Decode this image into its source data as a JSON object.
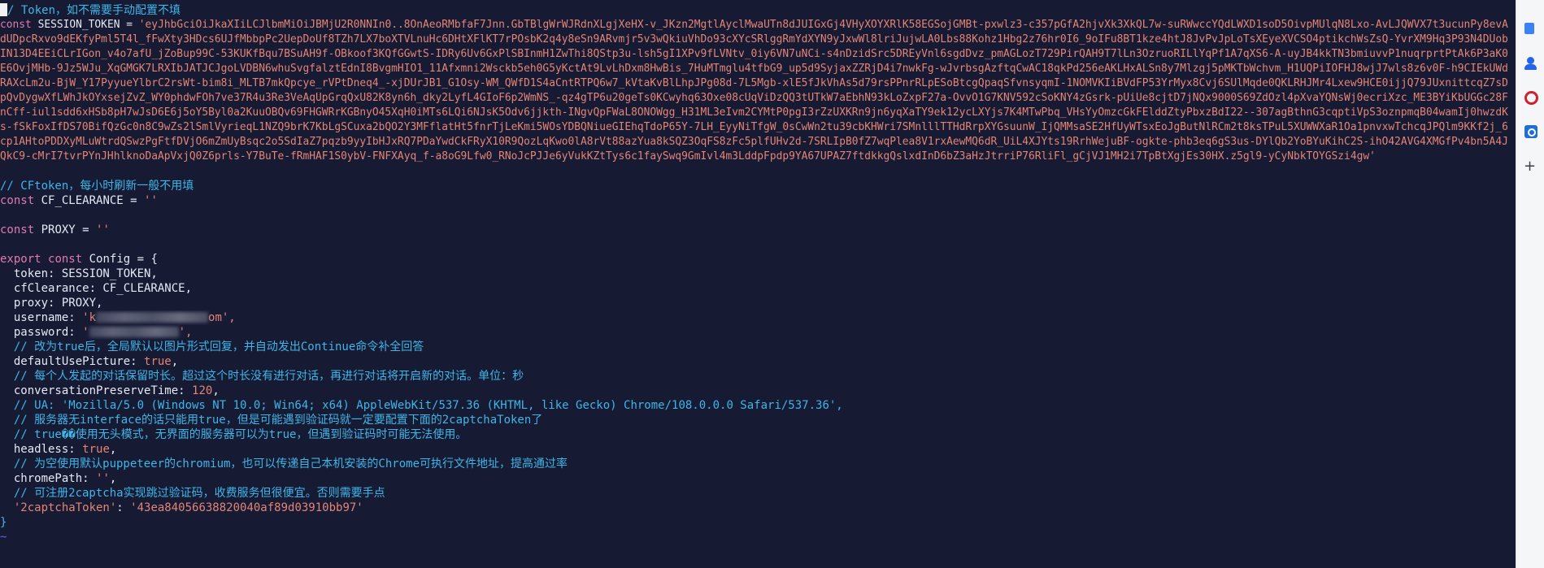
{
  "editor": {
    "comment_token": "/ Token，如不需要手动配置不填",
    "session_kw": "const",
    "session_name": "SESSION_TOKEN",
    "session_eq": " = ",
    "session_token_value": "'eyJhbGciOiJkaXIiLCJlbmMiOiJBMjU2R0NNIn0..8OnAeoRMbfaF7Jnn.GbTBlgWrWJRdnXLgjXeHX-v_JKzn2MgtlAyclMwaUTn8dJUIGxGj4VHyXOYXRlK58EGSojGMBt-pxwlz3-c357pGfA2hjvXk3XkQL7w-suRWwccYQdLWXD1soD5OivpMUlqN8Lxo-AvLJQWVX7t3ucunPy8evAdUDpcRxvo9dEKfyPml5T4l_fFwXty3HDcs6UJfMbbpPc2UepDoUf8TZh7LX7boXTVLnuHc6DHtXFlKT7rPOsbK2q4y8eSn9ARvmjr5v3wQkiuVhDo93cXYcSRlggRmYdXYN9yJxwWl8lriJujwLA0Lbs88Kohz1Hbg2z76hr0I6_9oIFu8BT1kze4htJ8JvPvJpLoTsXEyeXVCSO4ptikchWsZsQ-YvrXM9Hq3P93N4DUobIN13D4EEiCLrIGon_v4o7afU_jZoBup99C-53KUKfBqu7BSuAH9f-OBkoof3KQfGGwtS-IDRy6Uv6GxPlSBInmH1ZwThi8QStp3u-lsh5gI1XPv9fLVNtv_0iy6VN7uNCi-s4nDzidSrc5DREyVnl6sgdDvz_pmAGLozT729PirQAH9T7lLn3OzruoRILlYqPf1A7qXS6-A-uyJB4kkTN3bmiuvvP1nuqrprtPtAk6P3aK0E6OvjMHb-9Jz5WJu_XqGMGK7LRXIbJATJCJgoLVDBN6whuSvgfalztEdnI8BvgmHIO1_11Afxmni2Wsckb5eh0G5yKctAt9LvLhDxm8HwBis_7HuMTmglu4tfbG9_up5d9SyjaxZZRjD4i7nwkFg-wJvrbsgAzftqCwAC18qkPd256eAKLHxALSn8y7Mlzgj5pMKTbWchvm_H1UQPiIOFHJ8wjJ7wls8z6v0F-h9CIEkUWdRAXcLm2u-BjW_Y17PyyueYlbrC2rsWt-bim8i_MLTB7mkQpcye_rVPtDneq4_-xjDUrJB1_G1Osy-WM_QWfD1S4aCntRTPQ6w7_kVtaKvBlLhpJPg08d-7L5Mgb-xlE5fJkVhAs5d79rsPPnrRLpESoBtcgQpaqSfvnsyqmI-1NOMVKIiBVdFP53YrMyx8Cvj6SUlMqde0QKLRHJMr4Lxew9HCE0ijjQ79JUxnittcqZ7sDpQvDygwXfLWhJkOYxsejZvZ_WY0phdwFOh7ve37R4u3Re3VeAqUpGrqQxU82K8yn6h_dky2LyfL4GIoF6p2WmNS_-qz4gTP6u20geTs0KCwyhq63Oxe08cUqViDzQQ3tUTkW7aEbhN93kLoZxpF27a-OvvO1G7KNV592cSoKNY4zGsrk-pUiUe8cjtD7jNQx9000S69ZdOzl4pXvaYQNsWj0ecriXzc_ME3BYiKbUGGc28FnCff-iul1sdd6xHSb8pH7wJsD6E6j5oY5Byl0a2KuuOBQv69FHGWRrKGBnyO45XqH0iMTs6LQi6NJsK5Odv6jjkth-INgvQpFWaL8ONOWgg_H31ML3eIvm2CYMtP0pgI3rZzUXKRn9jn6yqXaTY9ek12ycLXYjs7K4MTwPbq_VHsYyOmzcGkFElddZtyPbxzBdI22--307agBthnG3cqptiVpS3oznpmqB04wamIj0hwzdKs-fSkFoxIfDS70BifQzGc0n8C9wZs2lSmlVyrieqL1NZQ9brK7KbLgSCuxa2bQO2Y3MFflatHt5fnrTjLeKmi5WOsYDBQNiueGIEhqTdoP65Y-7LH_EyyNiTfgW_0sCwWn2tu39cbKHWri7SMnlllTTHdRrpXYGsuunW_IjQMMsaSE2HfUyWTsxEoJgButNlRCm2t8ksTPuL5XUWWXaR1Oa1pnvxwTchcqJPQlm9KKf2j_6cp1AHtoPDDXyMLuWtrdQSwzPgFtfDVjO6mZmUyBsqc2o5SdIaZ7pqzb9yyIbHJxRQ7PDaYwdCkFRyX10R9QozLqKwo0lA8rVt88azYua8kSQZ3OqFS8zFc5plfUHv2d-7SRLIpB0fZ7wqPlea8V1rxAewMQ6dR_UiL4XJYts19RrhWejuBF-ogkte-phb3eq6gS3us-DYlQb2YoBYuKihC2S-ihO42AVG4XMGfPv4bn5A4JQkC9-cMrI7tvrPYnJHhlknoDaApVxjQ0Z6prls-Y7BuTe-fRmHAF1S0ybV-FNFXAyq_f-a8oG9Lfw0_RNoJcPJJe6yVukKZtTys6c1faySwq9GmIvl4m3LddpFpdp9YA67UPAZ7ftdkkgQslxdInD6bZ3aHzJtrriP76RliFl_gCjVJ1MH2i7TpBtXgjEs30HX.z5gl9-yCyNbkTOYGSzi4gw'",
    "comment_cftoken": "// CFtoken，每小时刷新一般不用填",
    "cf_kw": "const",
    "cf_name": "CF_CLEARANCE",
    "cf_eq": " = ",
    "cf_value": "''",
    "proxy_kw": "const",
    "proxy_name": "PROXY",
    "proxy_eq": " = ",
    "proxy_value": "''",
    "export_kw": "export",
    "export_const": "const",
    "config_name": "Config",
    "config_open": " = {",
    "token_line": "  token: SESSION_TOKEN,",
    "cf_line": "  cfClearance: CF_CLEARANCE,",
    "proxy_line": "  proxy: PROXY,",
    "username_key": "  username: ",
    "username_start": "'k",
    "username_end": "om',",
    "password_key": "  password: ",
    "password_start": "'",
    "password_end": "',",
    "comment_picture": "  // 改为true后，全局默认以图片形式回复，并自动发出Continue命令补全回答",
    "picture_key": "  defaultUsePicture: ",
    "picture_value": "true",
    "comment_preserve": "  // 每个人发起的对话保留时长。超过这个时长没有进行对话，再进行对话将开启新的对话。单位：秒",
    "preserve_key": "  conversationPreserveTime: ",
    "preserve_value": "120",
    "comment_ua": "  // UA: 'Mozilla/5.0 (Windows NT 10.0; Win64; x64) AppleWebKit/537.36 (KHTML, like Gecko) Chrome/108.0.0.0 Safari/537.36',",
    "comment_server": "  // 服务器无interface的话只能用true，但是可能遇到验证码就一定要配置下面的2captchaToken了",
    "comment_headless": "  // true��使用无头模式，无界面的服务器可以为true，但遇到验证码时可能无法使用。",
    "headless_key": "  headless: ",
    "headless_value": "true",
    "comment_chrome": "  // 为空使用默认puppeteer的chromium，也可以传递自己本机安装的Chrome可执行文件地址，提高通过率",
    "chrome_key": "  chromePath: ",
    "chrome_value": "''",
    "comment_captcha": "  // 可注册2captcha实现跳过验证码，收费服务但很便宜。否则需要手点",
    "captcha_key": "  '2captchaToken'",
    "captcha_colon": ": ",
    "captcha_value": "'43ea84056638820040af89d03910bb97'",
    "close_brace": "}",
    "tilde": "~"
  }
}
